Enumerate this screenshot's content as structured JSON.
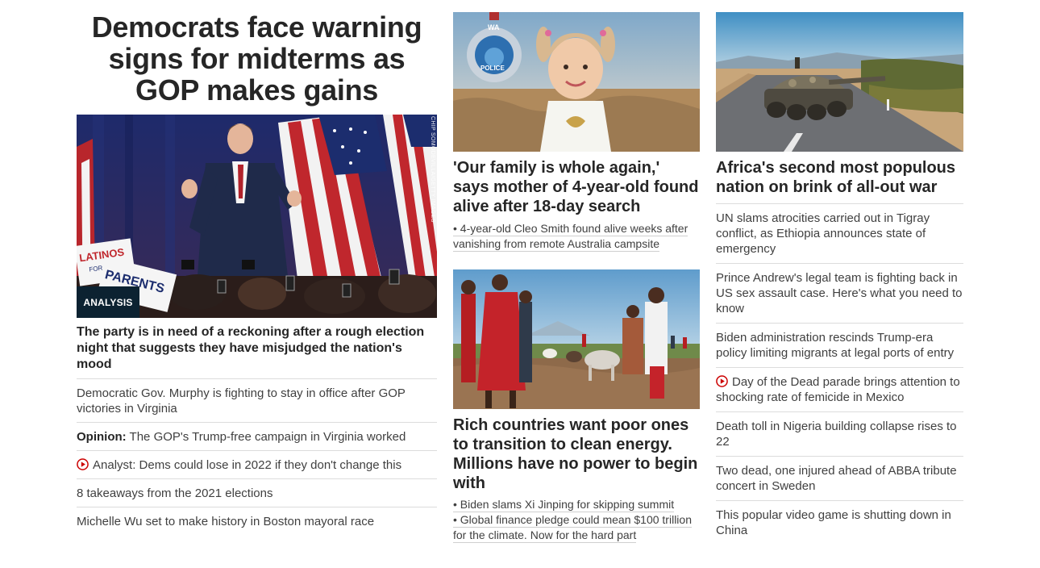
{
  "col1": {
    "headline": "Democrats face warning signs for midterms as GOP makes gains",
    "badge": "ANALYSIS",
    "photo_credit": "CHIP SOMODEVILLA/GETTY IMAGES",
    "sign_text_1": "LATINOS",
    "sign_text_2": "FOR",
    "sign_text_3": "PARENTS",
    "lead": "The party is in need of a reckoning after a rough election night that suggests they have misjudged the nation's mood",
    "items": [
      {
        "text": "Democratic Gov. Murphy is fighting to stay in office after GOP victories in Virginia"
      },
      {
        "prefix": "Opinion:",
        "text": " The GOP's Trump-free campaign in Virginia worked"
      },
      {
        "text": "Analyst: Dems could lose in 2022 if they don't change this",
        "video": true
      },
      {
        "text": "8 takeaways from the 2021 elections"
      },
      {
        "text": "Michelle Wu set to make history in Boston mayoral race"
      }
    ]
  },
  "col2": {
    "card1": {
      "badge_text_1": "WA",
      "badge_text_2": "POLICE",
      "title": "'Our family is whole again,' says mother of 4-year-old found alive after 18-day search",
      "bullets": [
        "• 4-year-old Cleo Smith found alive weeks after vanishing from remote Australia campsite"
      ]
    },
    "card2": {
      "title": "Rich countries want poor ones to transition to clean energy. Millions have no power to begin with",
      "bullets": [
        "• Biden slams Xi Jinping for skipping summit",
        "• Global finance pledge could mean $100 trillion for the climate. Now for the hard part"
      ]
    }
  },
  "col3": {
    "title": "Africa's second most populous nation on brink of all-out war",
    "items": [
      {
        "text": "UN slams atrocities carried out in Tigray conflict, as Ethiopia announces state of emergency"
      },
      {
        "text": "Prince Andrew's legal team is fighting back in US sex assault case. Here's what you need to know"
      },
      {
        "text": "Biden administration rescinds Trump-era policy limiting migrants at legal ports of entry"
      },
      {
        "text": "Day of the Dead parade brings attention to shocking rate of femicide in Mexico",
        "video": true
      },
      {
        "text": "Death toll in Nigeria building collapse rises to 22"
      },
      {
        "text": "Two dead, one injured ahead of ABBA tribute concert in Sweden"
      },
      {
        "text": "This popular video game is shutting down in China"
      }
    ]
  },
  "colors": {
    "text": "#262626",
    "muted": "#404040",
    "divider": "#dcdcdc",
    "badge_bg": "#0c2231",
    "video_red": "#cc0000"
  }
}
